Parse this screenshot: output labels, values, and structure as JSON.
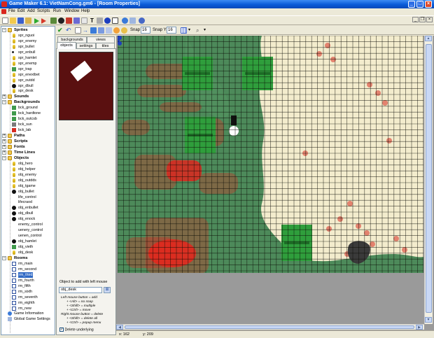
{
  "window": {
    "title": "Game Maker 6.1: VietNamCong.gm6 - [Room Properties]"
  },
  "menu": [
    "File",
    "Edit",
    "Add",
    "Scripts",
    "Run",
    "Window",
    "Help"
  ],
  "colors": {
    "grass": "#4d8a5a",
    "sand": "#f3eccd",
    "grid": "#0b0b05",
    "brick": "#d62b21",
    "wall_tile": "#2f9e3c",
    "preview_bg": "#5a1010",
    "titlebar": "#0a5ad8"
  },
  "room_toolbar": {
    "snapx_label": "Snap X:",
    "snapx": "16",
    "snapy_label": "Snap Y:",
    "snapy": "16"
  },
  "tabs": {
    "row1": [
      "backgrounds",
      "views"
    ],
    "row2": [
      "objects",
      "settings",
      "tiles"
    ]
  },
  "tree": [
    {
      "label": "Sprites",
      "type": "group",
      "level": 0
    },
    {
      "label": "spr_nguoi",
      "type": "item",
      "level": 1,
      "icon": "yellow-figure-icon"
    },
    {
      "label": "spr_enemy",
      "type": "item",
      "level": 1,
      "icon": "yellow-figure-icon"
    },
    {
      "label": "spr_bullet",
      "type": "item",
      "level": 1,
      "icon": "yellow-figure-icon"
    },
    {
      "label": "spr_enbull",
      "type": "item",
      "level": 1,
      "icon": "dot-icon"
    },
    {
      "label": "spr_hamlet",
      "type": "item",
      "level": 1,
      "icon": "yellow-figure-icon"
    },
    {
      "label": "spr_enemp",
      "type": "item",
      "level": 1,
      "icon": "yellow-figure-icon"
    },
    {
      "label": "spr_trap",
      "type": "item",
      "level": 1,
      "icon": "green-square-icon"
    },
    {
      "label": "spr_enextbet",
      "type": "item",
      "level": 1,
      "icon": "yellow-figure-icon"
    },
    {
      "label": "spr_outdd",
      "type": "item",
      "level": 1,
      "icon": "yellow-figure-icon"
    },
    {
      "label": "spr_dbull",
      "type": "item",
      "level": 1,
      "icon": "black-blob-icon"
    },
    {
      "label": "spr_desk",
      "type": "item",
      "level": 1,
      "icon": "yellow-figure-icon"
    },
    {
      "label": "Sounds",
      "type": "group",
      "level": 0
    },
    {
      "label": "Backgrounds",
      "type": "group",
      "level": 0
    },
    {
      "label": "bck_ground",
      "type": "item",
      "level": 1,
      "icon": "green-square-icon"
    },
    {
      "label": "bck_hardtone",
      "type": "item",
      "level": 1,
      "icon": "green-square-icon"
    },
    {
      "label": "bck_outcsb",
      "type": "item",
      "level": 1,
      "icon": "green-square-icon"
    },
    {
      "label": "bck_sun",
      "type": "item",
      "level": 1,
      "icon": "grey-square-icon"
    },
    {
      "label": "bck_lab",
      "type": "item",
      "level": 1,
      "icon": "red-square-icon"
    },
    {
      "label": "Paths",
      "type": "group",
      "level": 0
    },
    {
      "label": "Scripts",
      "type": "group",
      "level": 0
    },
    {
      "label": "Fonts",
      "type": "group",
      "level": 0
    },
    {
      "label": "Time Lines",
      "type": "group",
      "level": 0
    },
    {
      "label": "Objects",
      "type": "group",
      "level": 0
    },
    {
      "label": "obj_hero",
      "type": "item",
      "level": 1,
      "icon": "yellow-figure-icon"
    },
    {
      "label": "obj_helper",
      "type": "item",
      "level": 1,
      "icon": "yellow-figure-icon"
    },
    {
      "label": "obj_enemy",
      "type": "item",
      "level": 1,
      "icon": "yellow-figure-icon"
    },
    {
      "label": "obj_outdds",
      "type": "item",
      "level": 1,
      "icon": "yellow-figure-icon"
    },
    {
      "label": "obj_tgame",
      "type": "item",
      "level": 1,
      "icon": "yellow-figure-icon"
    },
    {
      "label": "obj_bullet",
      "type": "item",
      "level": 1,
      "icon": "black-blob-icon"
    },
    {
      "label": "life_control",
      "type": "item",
      "level": 1,
      "icon": "blank-icon"
    },
    {
      "label": "lifecraod",
      "type": "item",
      "level": 1,
      "icon": "blank-icon"
    },
    {
      "label": "obj_enbullet",
      "type": "item",
      "level": 1,
      "icon": "black-blob-icon"
    },
    {
      "label": "obj_dbull",
      "type": "item",
      "level": 1,
      "icon": "black-blob-icon"
    },
    {
      "label": "obj_enock",
      "type": "item",
      "level": 1,
      "icon": "black-blob-icon"
    },
    {
      "label": "enemy_control",
      "type": "item",
      "level": 1,
      "icon": "blank-icon"
    },
    {
      "label": "uenery_control",
      "type": "item",
      "level": 1,
      "icon": "blank-icon"
    },
    {
      "label": "uenen_control",
      "type": "item",
      "level": 1,
      "icon": "blank-icon"
    },
    {
      "label": "obj_hamlet",
      "type": "item",
      "level": 1,
      "icon": "black-blob-icon"
    },
    {
      "label": "obj_vieth",
      "type": "item",
      "level": 1,
      "icon": "green-square-icon"
    },
    {
      "label": "obj_desk",
      "type": "item",
      "level": 1,
      "icon": "yellow-figure-icon"
    },
    {
      "label": "Rooms",
      "type": "group",
      "level": 0
    },
    {
      "label": "rm_main",
      "type": "item",
      "level": 1,
      "icon": "room-icon"
    },
    {
      "label": "rm_second",
      "type": "item",
      "level": 1,
      "icon": "room-icon"
    },
    {
      "label": "rm_third",
      "type": "item",
      "level": 1,
      "icon": "room-icon",
      "selected": true
    },
    {
      "label": "rm_fourth",
      "type": "item",
      "level": 1,
      "icon": "room-icon"
    },
    {
      "label": "rm_fifth",
      "type": "item",
      "level": 1,
      "icon": "room-icon"
    },
    {
      "label": "rm_sixth",
      "type": "item",
      "level": 1,
      "icon": "room-icon"
    },
    {
      "label": "rm_seventh",
      "type": "item",
      "level": 1,
      "icon": "room-icon"
    },
    {
      "label": "rm_eighth",
      "type": "item",
      "level": 1,
      "icon": "room-icon"
    },
    {
      "label": "rm_new",
      "type": "item",
      "level": 1,
      "icon": "room-icon"
    },
    {
      "label": "Game Information",
      "type": "leaf",
      "level": 0,
      "icon": "info-icon"
    },
    {
      "label": "Global Game Settings",
      "type": "leaf",
      "level": 0,
      "icon": "settings-icon"
    }
  ],
  "objects_panel": {
    "add_label": "Object to add with left mouse",
    "selected_object": "obj_desk",
    "help_lines": [
      "Left mouse button = add",
      "+ <Alt> = no snap",
      "+ <Shift> = multiple",
      "+ <Ctrl> = move",
      "Right mouse button = delete",
      "+ <Shift> = delete all",
      "+ <Ctrl> = popup menu"
    ],
    "delete_underlying_label": "Delete underlying",
    "delete_underlying_checked": true
  },
  "status": {
    "x": "x: 162",
    "y": "y: 209"
  }
}
